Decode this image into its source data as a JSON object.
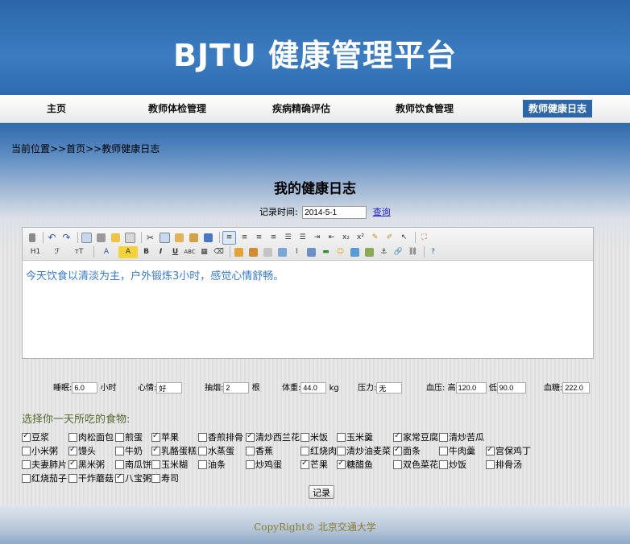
{
  "header": {
    "title": "BJTU 健康管理平台"
  },
  "nav": [
    {
      "label": "主页",
      "active": false
    },
    {
      "label": "教师体检管理",
      "active": false
    },
    {
      "label": "疾病精确评估",
      "active": false
    },
    {
      "label": "教师饮食管理",
      "active": false
    },
    {
      "label": "教师健康日志",
      "active": true
    }
  ],
  "breadcrumb": "当前位置>>首页>>教师健康日志",
  "page_title": "我的健康日志",
  "record": {
    "label": "记录时间:",
    "value": "2014-5-1",
    "query": "查询"
  },
  "toolbar": {
    "row1": [
      "source",
      "undo",
      "redo",
      "preview",
      "print",
      "template",
      "",
      "cut",
      "copy",
      "paste",
      "paste-text",
      "paste-word",
      "align-left",
      "align-center",
      "align-right",
      "align-justify",
      "ordered-list",
      "unordered-list",
      "indent",
      "outdent",
      "subscript",
      "superscript",
      "clear-format",
      "select-all",
      "fullscreen"
    ],
    "row2_labels": {
      "h1": "H1",
      "font": "ℱ",
      "size": "тT",
      "forecolor": "A",
      "hilite": "A",
      "bold": "B",
      "italic": "I",
      "underline": "U",
      "strike": "ABC"
    }
  },
  "editor": {
    "content": "今天饮食以清淡为主，户外锻炼3小时，感觉心情舒畅。"
  },
  "metrics": {
    "sleep": {
      "label": "睡眠:",
      "value": "6.0",
      "unit": "小时"
    },
    "mood": {
      "label": "心情:",
      "value": "好"
    },
    "smoke": {
      "label": "抽烟:",
      "value": "2",
      "unit": "根"
    },
    "weight": {
      "label": "体重:",
      "value": "44.0",
      "unit": "kg"
    },
    "pressure": {
      "label": "压力:",
      "value": "无"
    },
    "bp": {
      "label": "血压:",
      "high_label": "高",
      "high": "120.0",
      "low_label": "低",
      "low": "90.0"
    },
    "sugar": {
      "label": "血糖:",
      "value": "222.0"
    }
  },
  "food_title": "选择你一天所吃的食物:",
  "foods": [
    [
      {
        "n": "豆浆",
        "c": true
      },
      {
        "n": "肉松面包",
        "c": false
      },
      {
        "n": "煎蛋",
        "c": false
      },
      {
        "n": "苹果",
        "c": true
      },
      {
        "n": "香煎排骨",
        "c": false
      },
      {
        "n": "清炒西兰花",
        "c": true
      },
      {
        "n": "米饭",
        "c": false
      },
      {
        "n": "玉米羹",
        "c": false
      },
      {
        "n": "家常豆腐",
        "c": true
      },
      {
        "n": "清炒苦瓜",
        "c": false
      }
    ],
    [
      {
        "n": "小米粥",
        "c": false
      },
      {
        "n": "馒头",
        "c": true
      },
      {
        "n": "牛奶",
        "c": false
      },
      {
        "n": "乳酪蛋糕",
        "c": true
      },
      {
        "n": "水蒸蛋",
        "c": false
      },
      {
        "n": "香蕉",
        "c": false
      },
      {
        "n": "红烧肉",
        "c": false
      },
      {
        "n": "清炒油麦菜",
        "c": false
      },
      {
        "n": "面条",
        "c": true
      },
      {
        "n": "牛肉羹",
        "c": false
      },
      {
        "n": "宫保鸡丁",
        "c": true
      }
    ],
    [
      {
        "n": "夫妻肺片",
        "c": false
      },
      {
        "n": "黑米粥",
        "c": true
      },
      {
        "n": "南瓜饼",
        "c": false
      },
      {
        "n": "玉米糊",
        "c": false
      },
      {
        "n": "油条",
        "c": false
      },
      {
        "n": "炒鸡蛋",
        "c": false
      },
      {
        "n": "芒果",
        "c": true
      },
      {
        "n": "糖醋鱼",
        "c": true
      },
      {
        "n": "双色菜花",
        "c": false
      },
      {
        "n": "炒饭",
        "c": false
      },
      {
        "n": "排骨汤",
        "c": false
      }
    ],
    [
      {
        "n": "红烧茄子",
        "c": false
      },
      {
        "n": "干炸蘑菇",
        "c": false
      },
      {
        "n": "八宝粥",
        "c": true
      },
      {
        "n": "寿司",
        "c": false
      }
    ]
  ],
  "submit": "记录",
  "footer": "CopyRight© 北京交通大学"
}
